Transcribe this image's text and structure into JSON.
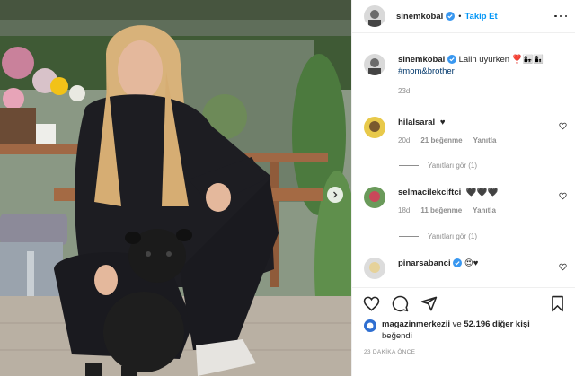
{
  "header": {
    "username": "sinemkobal",
    "separator": "•",
    "follow_label": "Takip Et"
  },
  "caption": {
    "username": "sinemkobal",
    "text": "Lalin uyurken ❣️👩‍👧👩‍👦",
    "hashtag": "#mom&brother",
    "time": "23d"
  },
  "comments": [
    {
      "username": "hilalsaral",
      "text": "♥",
      "time": "20d",
      "likes": "21 beğenme",
      "reply_label": "Yanıtla",
      "view_replies": "Yanıtları gör (1)"
    },
    {
      "username": "selmacilekciftci",
      "text": "🖤🖤🖤",
      "time": "18d",
      "likes": "11 beğenme",
      "reply_label": "Yanıtla",
      "view_replies": "Yanıtları gör (1)"
    },
    {
      "username": "pinarsabanci",
      "text": "😍♥",
      "time": "",
      "likes": "",
      "reply_label": "",
      "view_replies": ""
    }
  ],
  "likes_section": {
    "liker": "magazinmerkezii",
    "connector": " ve ",
    "others": "52.196 diğer kişi",
    "suffix": "beğendi"
  },
  "timestamp": "23 DAKİKA ÖNCE",
  "icons": {
    "verified_color": "#3897f0",
    "follow_color": "#0095f6",
    "like": "heart-icon",
    "comment": "comment-icon",
    "share": "share-icon",
    "save": "bookmark-icon",
    "carousel_next": "chevron-right-icon"
  }
}
